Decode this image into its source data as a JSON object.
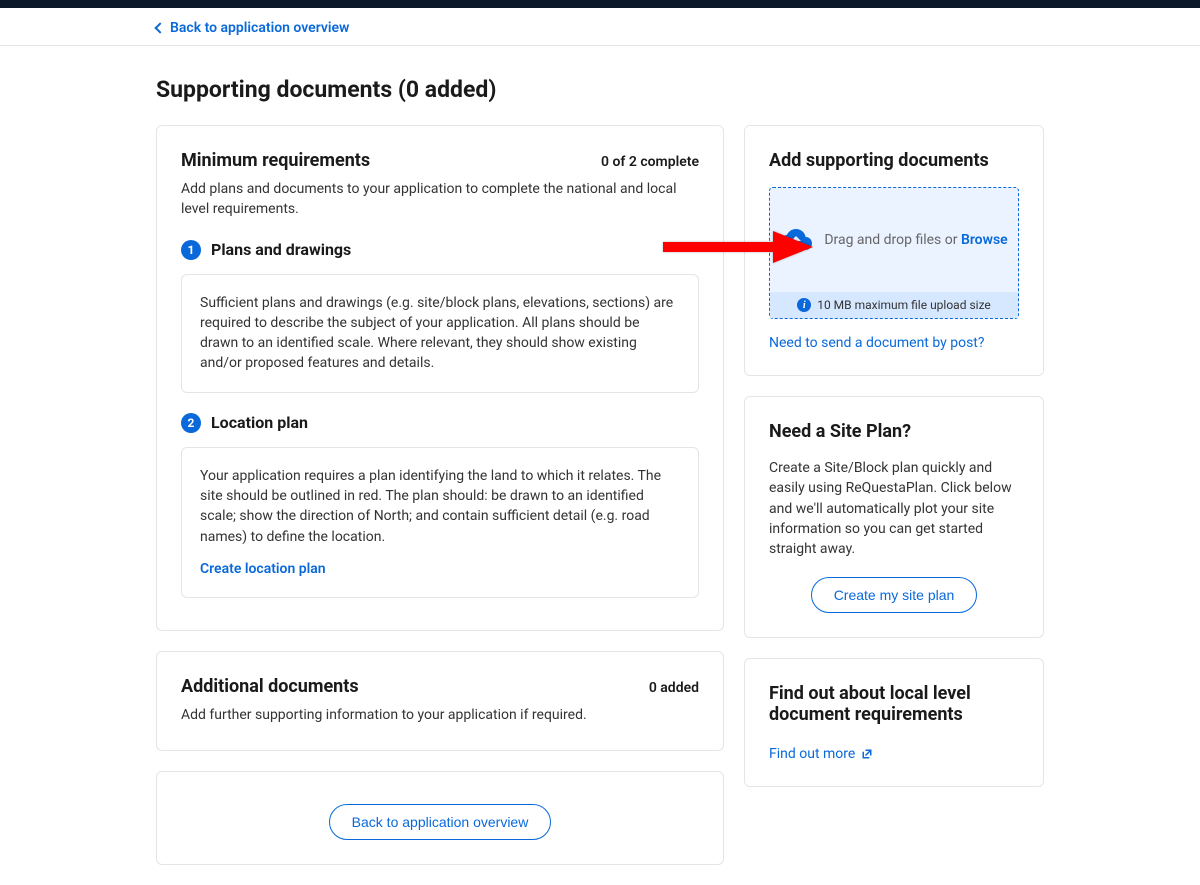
{
  "breadcrumb": {
    "back_label": "Back to application overview"
  },
  "page": {
    "title": "Supporting documents (0 added)"
  },
  "minimum": {
    "title": "Minimum requirements",
    "status": "0 of 2 complete",
    "description": "Add plans and documents to your application to complete the national and local level requirements.",
    "items": [
      {
        "num": "1",
        "title": "Plans and drawings",
        "body": "Sufficient plans and drawings (e.g. site/block plans, elevations, sections) are required to describe the subject of your application. All plans should be drawn to an identified scale. Where relevant, they should show existing and/or proposed features and details."
      },
      {
        "num": "2",
        "title": "Location plan",
        "body": "Your application requires a plan identifying the land to which it relates. The site should be outlined in red. The plan should: be drawn to an identified scale; show the direction of North; and contain sufficient detail (e.g. road names) to define the location.",
        "action": "Create location plan"
      }
    ]
  },
  "additional": {
    "title": "Additional documents",
    "status": "0 added",
    "description": "Add further supporting information to your application if required."
  },
  "backcard": {
    "button": "Back to application overview"
  },
  "upload": {
    "title": "Add supporting documents",
    "drag_text": "Drag and drop files or ",
    "browse": "Browse",
    "max_size": "10 MB maximum file upload size",
    "post_link": "Need to send a document by post?"
  },
  "siteplan": {
    "title": "Need a Site Plan?",
    "description": "Create a Site/Block plan quickly and easily using ReQuestaPlan. Click below and we'll automatically plot your site information so you can get started straight away.",
    "button": "Create my site plan"
  },
  "findout": {
    "title": "Find out about local level document requirements",
    "link": "Find out more"
  }
}
